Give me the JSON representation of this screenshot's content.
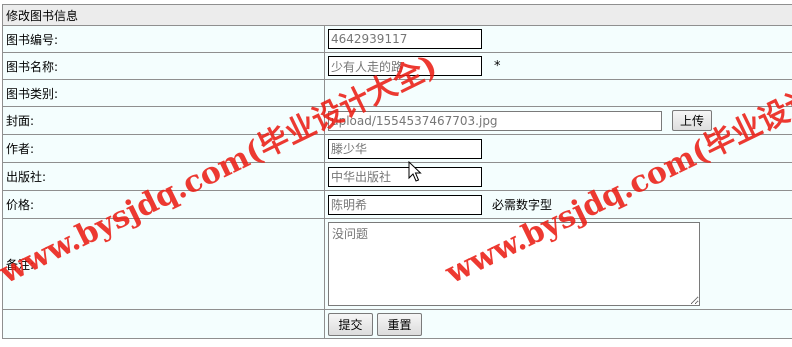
{
  "form": {
    "title": "修改图书信息",
    "fields": {
      "book_no": {
        "label": "图书编号:",
        "value": "4642939117"
      },
      "book_name": {
        "label": "图书名称:",
        "value": "少有人走的路",
        "required_mark": "*"
      },
      "book_category": {
        "label": "图书类别:"
      },
      "cover": {
        "label": "封面:",
        "value": "upload/1554537467703.jpg",
        "button_label": "上传"
      },
      "author": {
        "label": "作者:",
        "value": "滕少华"
      },
      "publisher": {
        "label": "出版社:",
        "value": "中华出版社"
      },
      "price": {
        "label": "价格:",
        "value": "陈明希",
        "hint": "必需数字型"
      },
      "remark": {
        "label": "备注:",
        "value": "没问题"
      }
    },
    "buttons": {
      "submit": "提交",
      "reset": "重置"
    }
  },
  "watermark": {
    "text": "www.bysjdq.com(毕业设计大全)",
    "color": "#eb1e14"
  },
  "icons": [
    "mouse-cursor-icon"
  ]
}
